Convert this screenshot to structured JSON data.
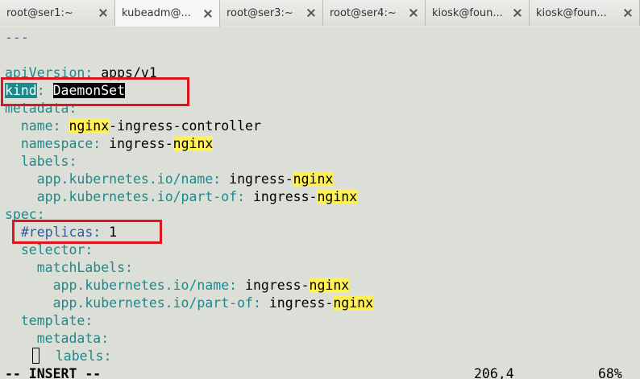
{
  "tabs": [
    {
      "label": "root@ser1:~",
      "active": false
    },
    {
      "label": "kubeadm@...",
      "active": true
    },
    {
      "label": "root@ser3:~",
      "active": false
    },
    {
      "label": "root@ser4:~",
      "active": false
    },
    {
      "label": "kiosk@foun...",
      "active": false
    },
    {
      "label": "kiosk@foun...",
      "active": false
    }
  ],
  "editor": {
    "doc_start": "---",
    "api_key": "apiVersion",
    "api_value": "apps/v1",
    "kind_key": "kind",
    "kind_value": "DaemonSet",
    "metadata_key": "metadata",
    "name_key": "name",
    "name_hl": "nginx",
    "name_rest": "-ingress-controller",
    "namespace_key": "namespace",
    "namespace_pre": "ingress-",
    "namespace_hl": "nginx",
    "labels_key": "labels",
    "label_name_key": "app.kubernetes.io/name",
    "label_name_pre": "ingress-",
    "label_name_hl": "nginx",
    "label_partof_key": "app.kubernetes.io/part-of",
    "label_partof_pre": "ingress-",
    "label_partof_hl": "nginx",
    "spec_key": "spec",
    "replicas_comment": "#replicas",
    "replicas_value": "1",
    "selector_key": "selector",
    "matchlabels_key": "matchLabels",
    "ml_name_key": "app.kubernetes.io/name",
    "ml_name_pre": "ingress-",
    "ml_name_hl": "nginx",
    "ml_partof_key": "app.kubernetes.io/part-of",
    "ml_partof_pre": "ingress-",
    "ml_partof_hl": "nginx",
    "template_key": "template",
    "tmeta_key": "metadata",
    "tlabels_key": "labels"
  },
  "status": {
    "mode": "-- INSERT --",
    "position": "206,4",
    "percent": "68%"
  }
}
